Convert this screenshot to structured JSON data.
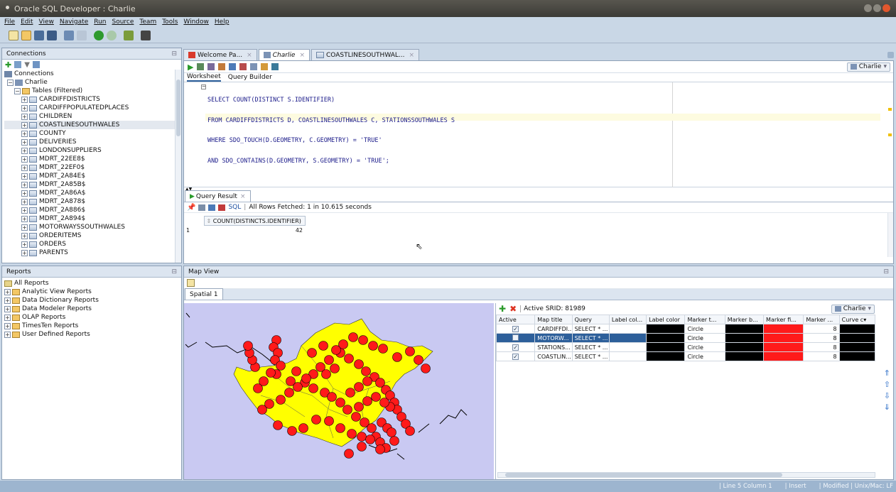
{
  "window": {
    "title": "Oracle SQL Developer : Charlie"
  },
  "menu": {
    "items": [
      "File",
      "Edit",
      "View",
      "Navigate",
      "Run",
      "Source",
      "Team",
      "Tools",
      "Window",
      "Help"
    ]
  },
  "connections_panel": {
    "title": "Connections",
    "root_label": "Connections",
    "connection_label": "Charlie",
    "tables_label": "Tables (Filtered)",
    "tables": [
      "CARDIFFDISTRICTS",
      "CARDIFFPOPULATEDPLACES",
      "CHILDREN",
      "COASTLINESOUTHWALES",
      "COUNTY",
      "DELIVERIES",
      "LONDONSUPPLIERS",
      "MDRT_22EE8$",
      "MDRT_22EF0$",
      "MDRT_2A84E$",
      "MDRT_2A85B$",
      "MDRT_2A86A$",
      "MDRT_2A878$",
      "MDRT_2A886$",
      "MDRT_2A894$",
      "MOTORWAYSSOUTHWALES",
      "ORDERITEMS",
      "ORDERS",
      "PARENTS"
    ]
  },
  "reports_panel": {
    "title": "Reports",
    "root_label": "All Reports",
    "items": [
      "Analytic View Reports",
      "Data Dictionary Reports",
      "Data Modeler Reports",
      "OLAP Reports",
      "TimesTen Reports",
      "User Defined Reports"
    ]
  },
  "editor_tabs": [
    {
      "label": "Welcome Pa..."
    },
    {
      "label": "Charlie"
    },
    {
      "label": "COASTLINESOUTHWAL..."
    }
  ],
  "editor": {
    "connection_select": "Charlie",
    "subtabs": [
      "Worksheet",
      "Query Builder"
    ],
    "sql_lines": [
      "SELECT COUNT(DISTINCT S.IDENTIFIER)",
      "FROM CARDIFFDISTRICTS D, COASTLINESOUTHWALES C, STATIONSSOUTHWALES S",
      "WHERE SDO_TOUCH(D.GEOMETRY, C.GEOMETRY) = 'TRUE'",
      "AND SDO_CONTAINS(D.GEOMETRY, S.GEOMETRY) = 'TRUE';"
    ]
  },
  "query_result": {
    "tab_label": "Query Result",
    "sql_link": "SQL",
    "status": "All Rows Fetched: 1 in 10.615 seconds",
    "column": "COUNT(DISTINCTS.IDENTIFIER)",
    "row_num": "1",
    "value": "42"
  },
  "map_view": {
    "title": "Map View",
    "tab": "Spatial 1",
    "srid_label": "Active SRID: 81989",
    "connection_select": "Charlie",
    "headers": [
      "Active",
      "Map title",
      "Query",
      "Label col...",
      "Label color",
      "Marker t...",
      "Marker b...",
      "Marker fi...",
      "Marker ...",
      "Curve c"
    ],
    "rows": [
      {
        "active": true,
        "title": "CARDIFFDI...",
        "query": "SELECT * ...",
        "marker": "Circle",
        "size": "8"
      },
      {
        "active": false,
        "title": "MOTORW...",
        "query": "SELECT * ...",
        "marker": "Circle",
        "size": "8"
      },
      {
        "active": true,
        "title": "STATIONS...",
        "query": "SELECT * ...",
        "marker": "Circle",
        "size": "8"
      },
      {
        "active": true,
        "title": "COASTLIN...",
        "query": "SELECT * ...",
        "marker": "Circle",
        "size": "8"
      }
    ]
  },
  "statusbar": {
    "position": "| Line 5 Column 1",
    "mode": "| Insert",
    "state": "| Modified | Unix/Mac: LF"
  },
  "colors": {
    "accent": "#2d5f9a",
    "marker_fill": "#ff1a1a",
    "map_bg": "#c9c9f2",
    "region": "#ffff00"
  }
}
